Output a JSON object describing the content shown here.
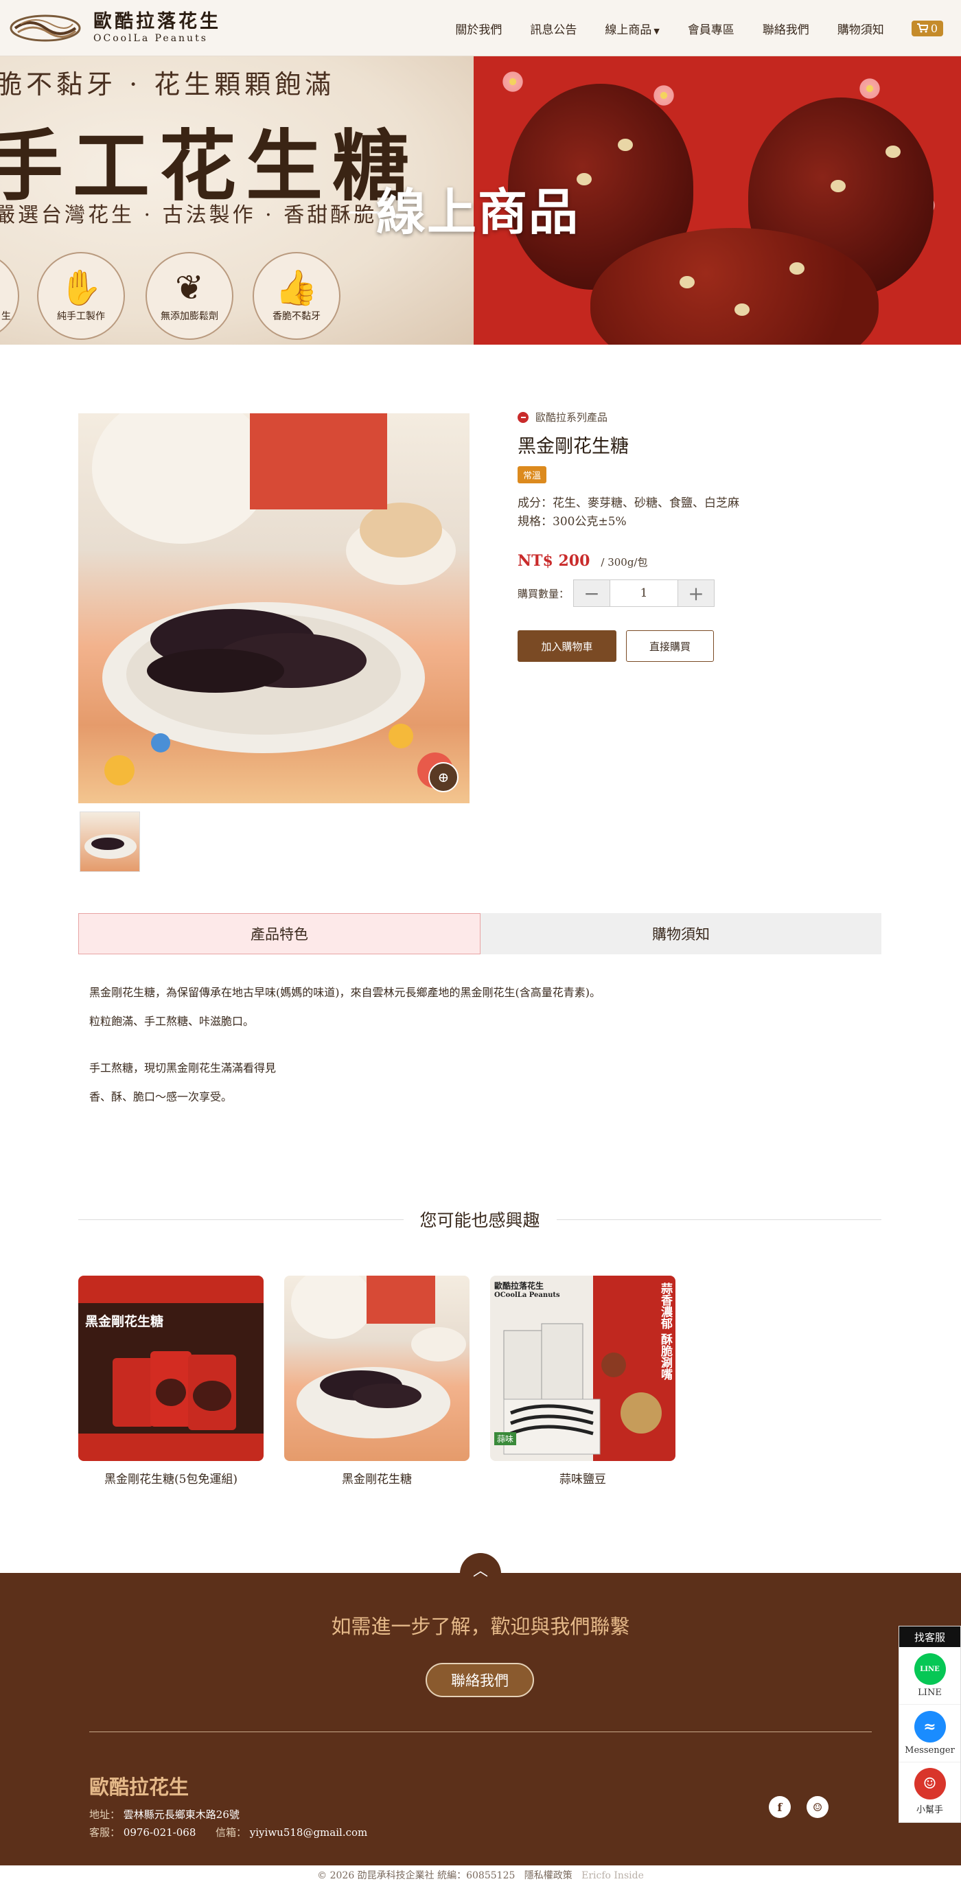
{
  "header": {
    "logo_cn": "歐酷拉落花生",
    "logo_en": "OCoolLa Peanuts",
    "nav": [
      "關於我們",
      "訊息公告",
      "線上商品",
      "會員專區",
      "聯絡我們",
      "購物須知"
    ],
    "cart_count": "0",
    "cart_icon": "cart-icon"
  },
  "banner": {
    "line1": "脆不黏牙 · 花生顆顆飽滿",
    "line2": "手工花生糖",
    "line3": "嚴選台灣花生 · 古法製作 · 香甜酥脆",
    "overlay": "線上商品",
    "badges": [
      "生",
      "純手工製作",
      "無添加膨鬆劑",
      "香脆不黏牙"
    ]
  },
  "product": {
    "series": "歐酷拉系列產品",
    "title": "黑金剛花生糖",
    "tag": "常溫",
    "ingredients": "成分：花生、麥芽糖、砂糖、食鹽、白芝麻",
    "spec": "規格：300公克±5%",
    "price": "NT$ 200",
    "unit": "/ 300g/包",
    "qty_label": "購買數量：",
    "qty_value": "1",
    "minus": "−",
    "plus": "+",
    "add_cart": "加入購物車",
    "buy_now": "直接購買",
    "zoom_icon": "zoom-in-icon"
  },
  "tabs": [
    "產品特色",
    "購物須知"
  ],
  "description": [
    "黑金剛花生糖，為保留傳承在地古早味(媽媽的味道)，來自雲林元長鄉產地的黑金剛花生(含高量花青素)。",
    "粒粒飽滿、手工熬糖、咔滋脆口。",
    "手工熬糖，現切黑金剛花生滿滿看得見",
    "香、酥、脆口～感一次享受。"
  ],
  "related": {
    "heading": "您可能也感興趣",
    "items": [
      {
        "name": "黑金剛花生糖(5包免運組)",
        "overlay": "黑金剛花生糖"
      },
      {
        "name": "黑金剛花生糖",
        "overlay": ""
      },
      {
        "name": "蒜味鹽豆",
        "overlay": "蒜香濃郁 酥脆涮嘴"
      }
    ],
    "card3_brand": "歐酷拉落花生",
    "card3_brand_en": "OCoolLa Peanuts",
    "card3_tag": "蒜味"
  },
  "footer": {
    "up_icon": "chevron-up-icon",
    "headline": "如需進一步了解，歡迎與我們聯繫",
    "contact_btn": "聯絡我們",
    "company": "歐酷拉花生",
    "address_label": "地址：",
    "address": "雲林縣元長鄉東木路26號",
    "phone_label": "客服：",
    "phone": "0976-021-068",
    "email_label": "信箱：",
    "email": "yiyiwu518@gmail.com",
    "social": [
      "f",
      "☺"
    ],
    "copyright": "© 2026 劭昆承科技企業社 統編：60855125",
    "privacy": "隱私權政策",
    "powered": "Ericfo Inside"
  },
  "side_widget": {
    "title": "找客服",
    "items": [
      {
        "label": "LINE",
        "icon_text": "LINE",
        "color": "#06c755"
      },
      {
        "label": "Messenger",
        "icon_text": "≈",
        "color": "#1a8cff"
      },
      {
        "label": "小幫手",
        "icon_text": "☺",
        "color": "#d9352b"
      }
    ]
  },
  "colors": {
    "brand_brown": "#5c301a",
    "accent_gold": "#c58b2a",
    "price_red": "#c92b2b",
    "tag_orange": "#dc8a1e"
  }
}
